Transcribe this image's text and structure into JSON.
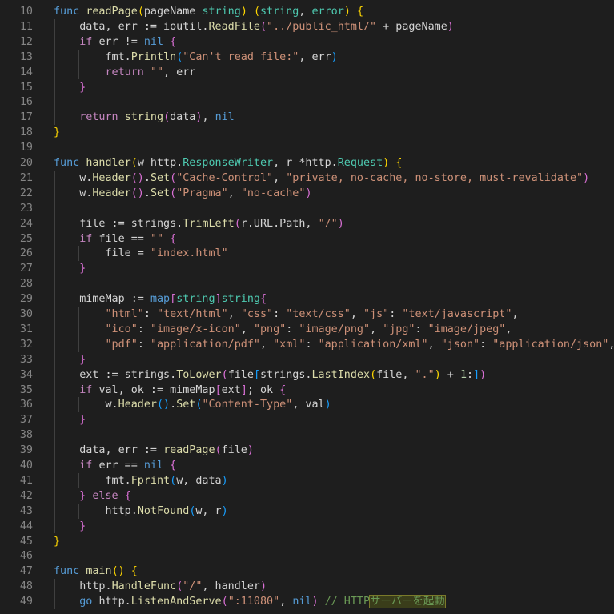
{
  "editor": {
    "lines": [
      {
        "n": "10",
        "segs": [
          [
            "func ",
            "kw"
          ],
          [
            "readPage",
            "fn"
          ],
          [
            "(",
            "b1"
          ],
          [
            "pageName ",
            "pl"
          ],
          [
            "string",
            "ty"
          ],
          [
            ") ",
            "b1"
          ],
          [
            "(",
            "b1"
          ],
          [
            "string",
            "ty"
          ],
          [
            ", ",
            "pl"
          ],
          [
            "error",
            "ty"
          ],
          [
            ") ",
            "b1"
          ],
          [
            "{",
            "b1"
          ]
        ]
      },
      {
        "n": "11",
        "segs": [
          [
            "    data, err := ioutil.",
            "pl"
          ],
          [
            "ReadFile",
            "fn"
          ],
          [
            "(",
            "b2"
          ],
          [
            "\"../public_html/\"",
            "str"
          ],
          [
            " + pageName",
            "pl"
          ],
          [
            ")",
            "b2"
          ]
        ]
      },
      {
        "n": "12",
        "segs": [
          [
            "    if ",
            "ctl"
          ],
          [
            "err != ",
            "pl"
          ],
          [
            "nil ",
            "kw"
          ],
          [
            "{",
            "b2"
          ]
        ]
      },
      {
        "n": "13",
        "segs": [
          [
            "        fmt.",
            "pl"
          ],
          [
            "Println",
            "fn"
          ],
          [
            "(",
            "b3"
          ],
          [
            "\"Can't read file:\"",
            "str"
          ],
          [
            ", err",
            "pl"
          ],
          [
            ")",
            "b3"
          ]
        ]
      },
      {
        "n": "14",
        "segs": [
          [
            "        return ",
            "ctl"
          ],
          [
            "\"\"",
            "str"
          ],
          [
            ", err",
            "pl"
          ]
        ]
      },
      {
        "n": "15",
        "segs": [
          [
            "    }",
            "b2"
          ]
        ]
      },
      {
        "n": "16",
        "segs": []
      },
      {
        "n": "17",
        "segs": [
          [
            "    return ",
            "ctl"
          ],
          [
            "string",
            "fn"
          ],
          [
            "(",
            "b2"
          ],
          [
            "data",
            "pl"
          ],
          [
            ")",
            "b2"
          ],
          [
            ", ",
            "pl"
          ],
          [
            "nil",
            "kw"
          ]
        ]
      },
      {
        "n": "18",
        "segs": [
          [
            "}",
            "b1"
          ]
        ]
      },
      {
        "n": "19",
        "segs": []
      },
      {
        "n": "20",
        "segs": [
          [
            "func ",
            "kw"
          ],
          [
            "handler",
            "fn"
          ],
          [
            "(",
            "b1"
          ],
          [
            "w http.",
            "pl"
          ],
          [
            "ResponseWriter",
            "ty"
          ],
          [
            ", r *http.",
            "pl"
          ],
          [
            "Request",
            "ty"
          ],
          [
            ") ",
            "b1"
          ],
          [
            "{",
            "b1"
          ]
        ]
      },
      {
        "n": "21",
        "segs": [
          [
            "    w.",
            "pl"
          ],
          [
            "Header",
            "fn"
          ],
          [
            "()",
            "b2"
          ],
          [
            ".",
            "pl"
          ],
          [
            "Set",
            "fn"
          ],
          [
            "(",
            "b2"
          ],
          [
            "\"Cache-Control\"",
            "str"
          ],
          [
            ", ",
            "pl"
          ],
          [
            "\"private, no-cache, no-store, must-revalidate\"",
            "str"
          ],
          [
            ")",
            "b2"
          ]
        ]
      },
      {
        "n": "22",
        "segs": [
          [
            "    w.",
            "pl"
          ],
          [
            "Header",
            "fn"
          ],
          [
            "()",
            "b2"
          ],
          [
            ".",
            "pl"
          ],
          [
            "Set",
            "fn"
          ],
          [
            "(",
            "b2"
          ],
          [
            "\"Pragma\"",
            "str"
          ],
          [
            ", ",
            "pl"
          ],
          [
            "\"no-cache\"",
            "str"
          ],
          [
            ")",
            "b2"
          ]
        ]
      },
      {
        "n": "23",
        "segs": []
      },
      {
        "n": "24",
        "segs": [
          [
            "    file := strings.",
            "pl"
          ],
          [
            "TrimLeft",
            "fn"
          ],
          [
            "(",
            "b2"
          ],
          [
            "r.URL.Path, ",
            "pl"
          ],
          [
            "\"/\"",
            "str"
          ],
          [
            ")",
            "b2"
          ]
        ]
      },
      {
        "n": "25",
        "segs": [
          [
            "    if ",
            "ctl"
          ],
          [
            "file == ",
            "pl"
          ],
          [
            "\"\"",
            "str"
          ],
          [
            " ",
            "pl"
          ],
          [
            "{",
            "b2"
          ]
        ]
      },
      {
        "n": "26",
        "segs": [
          [
            "        file = ",
            "pl"
          ],
          [
            "\"index.html\"",
            "str"
          ]
        ]
      },
      {
        "n": "27",
        "segs": [
          [
            "    }",
            "b2"
          ]
        ]
      },
      {
        "n": "28",
        "segs": []
      },
      {
        "n": "29",
        "segs": [
          [
            "    mimeMap := ",
            "pl"
          ],
          [
            "map",
            "kw"
          ],
          [
            "[",
            "b2"
          ],
          [
            "string",
            "ty"
          ],
          [
            "]",
            "b2"
          ],
          [
            "string",
            "ty"
          ],
          [
            "{",
            "b2"
          ]
        ]
      },
      {
        "n": "30",
        "segs": [
          [
            "        \"html\"",
            "str"
          ],
          [
            ": ",
            "pl"
          ],
          [
            "\"text/html\"",
            "str"
          ],
          [
            ", ",
            "pl"
          ],
          [
            "\"css\"",
            "str"
          ],
          [
            ": ",
            "pl"
          ],
          [
            "\"text/css\"",
            "str"
          ],
          [
            ", ",
            "pl"
          ],
          [
            "\"js\"",
            "str"
          ],
          [
            ": ",
            "pl"
          ],
          [
            "\"text/javascript\"",
            "str"
          ],
          [
            ",",
            "pl"
          ]
        ]
      },
      {
        "n": "31",
        "segs": [
          [
            "        \"ico\"",
            "str"
          ],
          [
            ": ",
            "pl"
          ],
          [
            "\"image/x-icon\"",
            "str"
          ],
          [
            ", ",
            "pl"
          ],
          [
            "\"png\"",
            "str"
          ],
          [
            ": ",
            "pl"
          ],
          [
            "\"image/png\"",
            "str"
          ],
          [
            ", ",
            "pl"
          ],
          [
            "\"jpg\"",
            "str"
          ],
          [
            ": ",
            "pl"
          ],
          [
            "\"image/jpeg\"",
            "str"
          ],
          [
            ",",
            "pl"
          ]
        ]
      },
      {
        "n": "32",
        "segs": [
          [
            "        \"pdf\"",
            "str"
          ],
          [
            ": ",
            "pl"
          ],
          [
            "\"application/pdf\"",
            "str"
          ],
          [
            ", ",
            "pl"
          ],
          [
            "\"xml\"",
            "str"
          ],
          [
            ": ",
            "pl"
          ],
          [
            "\"application/xml\"",
            "str"
          ],
          [
            ", ",
            "pl"
          ],
          [
            "\"json\"",
            "str"
          ],
          [
            ": ",
            "pl"
          ],
          [
            "\"application/json\"",
            "str"
          ],
          [
            ",",
            "pl"
          ]
        ]
      },
      {
        "n": "33",
        "segs": [
          [
            "    }",
            "b2"
          ]
        ]
      },
      {
        "n": "34",
        "segs": [
          [
            "    ext := strings.",
            "pl"
          ],
          [
            "ToLower",
            "fn"
          ],
          [
            "(",
            "b2"
          ],
          [
            "file",
            "pl"
          ],
          [
            "[",
            "b3"
          ],
          [
            "strings.",
            "pl"
          ],
          [
            "LastIndex",
            "fn"
          ],
          [
            "(",
            "b1"
          ],
          [
            "file, ",
            "pl"
          ],
          [
            "\".\"",
            "str"
          ],
          [
            ")",
            "b1"
          ],
          [
            " + ",
            "pl"
          ],
          [
            "1",
            "num"
          ],
          [
            ":",
            "pl"
          ],
          [
            "]",
            "b3"
          ],
          [
            ")",
            "b2"
          ]
        ]
      },
      {
        "n": "35",
        "segs": [
          [
            "    if ",
            "ctl"
          ],
          [
            "val, ok := mimeMap",
            "pl"
          ],
          [
            "[",
            "b2"
          ],
          [
            "ext",
            "pl"
          ],
          [
            "]",
            "b2"
          ],
          [
            "; ok ",
            "pl"
          ],
          [
            "{",
            "b2"
          ]
        ]
      },
      {
        "n": "36",
        "segs": [
          [
            "        w.",
            "pl"
          ],
          [
            "Header",
            "fn"
          ],
          [
            "()",
            "b3"
          ],
          [
            ".",
            "pl"
          ],
          [
            "Set",
            "fn"
          ],
          [
            "(",
            "b3"
          ],
          [
            "\"Content-Type\"",
            "str"
          ],
          [
            ", val",
            "pl"
          ],
          [
            ")",
            "b3"
          ]
        ]
      },
      {
        "n": "37",
        "segs": [
          [
            "    }",
            "b2"
          ]
        ]
      },
      {
        "n": "38",
        "segs": []
      },
      {
        "n": "39",
        "segs": [
          [
            "    data, err := ",
            "pl"
          ],
          [
            "readPage",
            "fn"
          ],
          [
            "(",
            "b2"
          ],
          [
            "file",
            "pl"
          ],
          [
            ")",
            "b2"
          ]
        ]
      },
      {
        "n": "40",
        "segs": [
          [
            "    if ",
            "ctl"
          ],
          [
            "err == ",
            "pl"
          ],
          [
            "nil ",
            "kw"
          ],
          [
            "{",
            "b2"
          ]
        ]
      },
      {
        "n": "41",
        "segs": [
          [
            "        fmt.",
            "pl"
          ],
          [
            "Fprint",
            "fn"
          ],
          [
            "(",
            "b3"
          ],
          [
            "w, data",
            "pl"
          ],
          [
            ")",
            "b3"
          ]
        ]
      },
      {
        "n": "42",
        "segs": [
          [
            "    } ",
            "b2"
          ],
          [
            "else ",
            "ctl"
          ],
          [
            "{",
            "b2"
          ]
        ]
      },
      {
        "n": "43",
        "segs": [
          [
            "        http.",
            "pl"
          ],
          [
            "NotFound",
            "fn"
          ],
          [
            "(",
            "b3"
          ],
          [
            "w, r",
            "pl"
          ],
          [
            ")",
            "b3"
          ]
        ]
      },
      {
        "n": "44",
        "segs": [
          [
            "    }",
            "b2"
          ]
        ]
      },
      {
        "n": "45",
        "segs": [
          [
            "}",
            "b1"
          ]
        ]
      },
      {
        "n": "46",
        "segs": []
      },
      {
        "n": "47",
        "segs": [
          [
            "func ",
            "kw"
          ],
          [
            "main",
            "fn"
          ],
          [
            "()",
            "b1"
          ],
          [
            " ",
            "pl"
          ],
          [
            "{",
            "b1"
          ]
        ]
      },
      {
        "n": "48",
        "segs": [
          [
            "    http.",
            "pl"
          ],
          [
            "HandleFunc",
            "fn"
          ],
          [
            "(",
            "b2"
          ],
          [
            "\"/\"",
            "str"
          ],
          [
            ", handler",
            "pl"
          ],
          [
            ")",
            "b2"
          ]
        ]
      },
      {
        "n": "49",
        "segs": [
          [
            "    go ",
            "kw"
          ],
          [
            "http.",
            "pl"
          ],
          [
            "ListenAndServe",
            "fn"
          ],
          [
            "(",
            "b2"
          ],
          [
            "\":11080\"",
            "str"
          ],
          [
            ", ",
            "pl"
          ],
          [
            "nil",
            "kw"
          ],
          [
            ")",
            "b2"
          ],
          [
            " // HTTP",
            "cm"
          ],
          [
            "サーバーを起動",
            "cm hl"
          ]
        ]
      }
    ]
  }
}
